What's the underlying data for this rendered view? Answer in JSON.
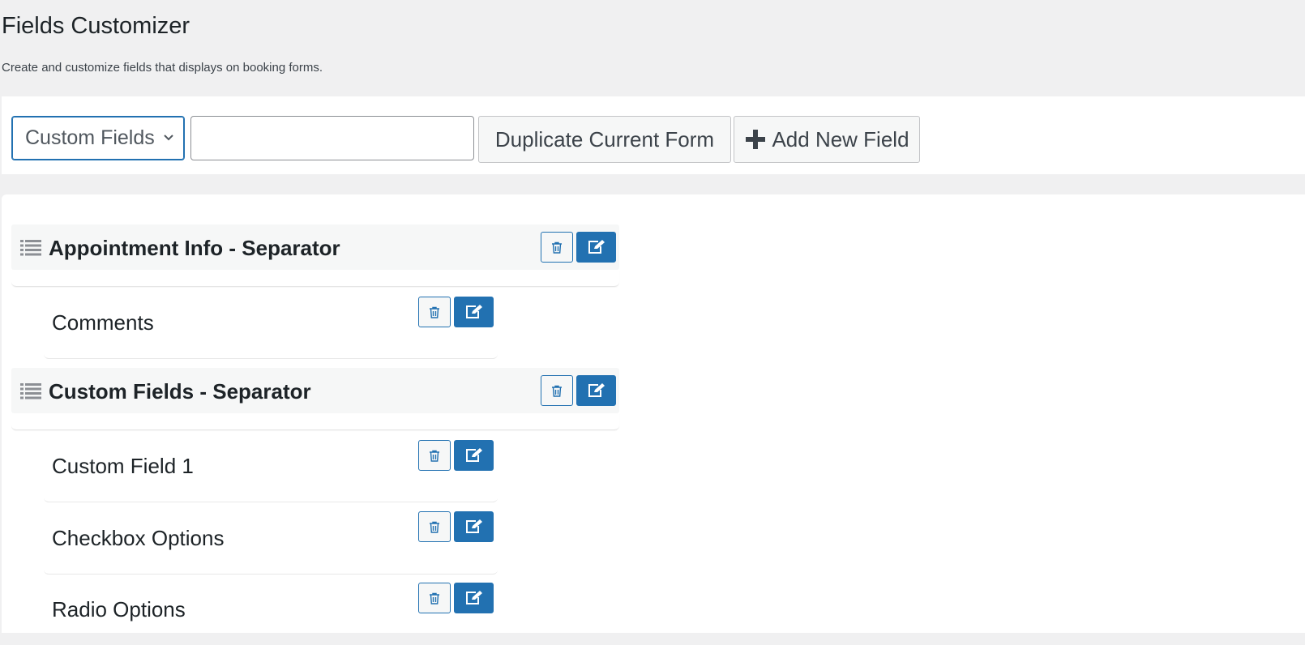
{
  "page": {
    "title": "Fields Customizer",
    "description": "Create and customize fields that displays on booking forms."
  },
  "toolbar": {
    "form_select": {
      "selected": "Custom Fields"
    },
    "name_input": {
      "value": "",
      "placeholder": ""
    },
    "duplicate_label": "Duplicate Current Form",
    "add_label": "Add New Field"
  },
  "fields": [
    {
      "type": "separator",
      "label": "Appointment Info - Separator"
    },
    {
      "type": "field",
      "label": "Comments"
    },
    {
      "type": "separator",
      "label": "Custom Fields - Separator"
    },
    {
      "type": "field",
      "label": "Custom Field 1"
    },
    {
      "type": "field",
      "label": "Checkbox Options"
    },
    {
      "type": "field",
      "label": "Radio Options"
    }
  ],
  "icons": {
    "separator": "list-icon",
    "delete": "trash-icon",
    "edit": "edit-icon",
    "add": "plus-icon",
    "select": "chevron-down-icon"
  },
  "colors": {
    "accent": "#2271b1",
    "background": "#f0f0f1",
    "panel": "#ffffff",
    "separator_bg": "#f6f7f7"
  }
}
